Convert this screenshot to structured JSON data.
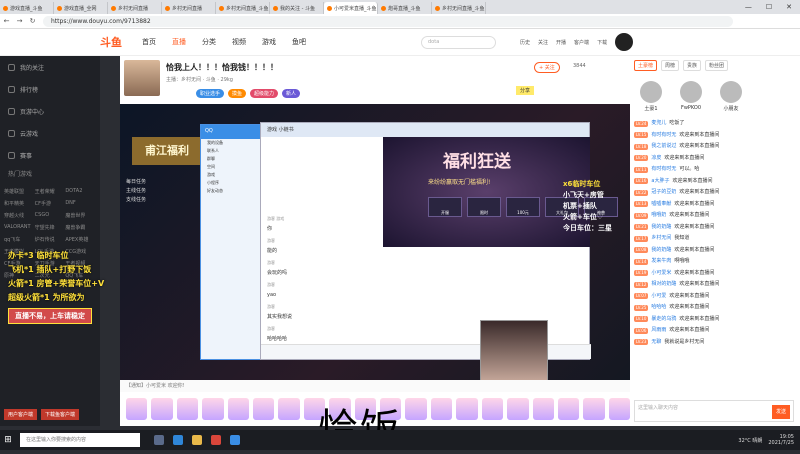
{
  "browser": {
    "tabs": [
      "游戏直播_斗鱼",
      "游戏直播_全网",
      "乡村无间直播",
      "乡村无间直播",
      "乡村无间直播_斗鱼",
      "我的关注 - 斗鱼",
      "小可爱米直播_斗鱼",
      "炮哥直播_斗鱼",
      "乡村无间直播_斗鱼"
    ],
    "url": "https://www.douyu.com/9713882"
  },
  "site": {
    "logo": "斗鱼",
    "nav": [
      "首页",
      "直播",
      "分类",
      "视频",
      "游戏",
      "鱼吧"
    ],
    "search_placeholder": "dota",
    "user_icons": [
      "历史",
      "关注",
      "开播",
      "客户端",
      "下载"
    ]
  },
  "sidebar": {
    "items": [
      "我的关注",
      "排行榜",
      "页游中心",
      "云游戏",
      "赛事"
    ],
    "section": "热门游戏",
    "games": [
      "英雄联盟",
      "王者荣耀",
      "DOTA2",
      "和平精英",
      "CF手游",
      "DNF",
      "穿越火线",
      "CSGO",
      "魔兽世界",
      "VALORANT",
      "守望先锋",
      "魔兽争霸",
      "qq飞车",
      "炉石传说",
      "APEX英雄",
      "王者模拟",
      "LOL手游",
      "CCG游戏",
      "CF手游",
      "天刀手游",
      "王者视频",
      "原神",
      "二次元",
      "QQ飞车"
    ],
    "bottom": [
      "用户客户端",
      "下载鱼客户端"
    ]
  },
  "room": {
    "title": "恰我上人！！！恰我钱！！！！",
    "streamer": "小可爱米",
    "meta": "主播：乡村无间 · 斗鱼 · 29kg",
    "tags": [
      "职业选手",
      "摸鱼",
      "超级能力",
      "新人"
    ],
    "follow_label": "+ 关注",
    "follow_count": "3844",
    "share_label": "分享"
  },
  "video": {
    "flag_text": "甫江福利",
    "tasks": [
      "每日任务",
      "主线任务",
      "支线任务"
    ],
    "qq_title": "QQ",
    "qq_rows": [
      "我的设备",
      "联系人",
      "群聊",
      "空间",
      "游戏",
      "小程序",
      "好友动态"
    ],
    "chat_title": "游戏 小链书",
    "banner_title": "福利狂送",
    "banner_sub": "来纷纷赢取无门槛福利!",
    "gift_cards": [
      "开服",
      "限时",
      "100元",
      "大礼包",
      "神兽"
    ],
    "chat_lines": [
      {
        "name": "游客 游戏",
        "text": "你"
      },
      {
        "name": "游客",
        "text": "能的"
      },
      {
        "name": "游客",
        "text": "会玩的吗"
      },
      {
        "name": "游客",
        "text": "yao"
      },
      {
        "name": "游客",
        "text": "其实我想说"
      },
      {
        "name": "游客",
        "text": "哈哈哈哈"
      }
    ],
    "overlay_left": [
      "办卡*3 临时车位",
      "飞机*1 插队+打野下饭",
      "火箭*1 房管+荣誉车位+V",
      "超级火箭*1 为所欲为"
    ],
    "overlay_box": "直播不易，上车请稳定",
    "overlay_right": [
      "x6临时车位",
      "小飞天+房管",
      "机票+插队",
      "火箭+车位♡",
      "今日车位：三星"
    ]
  },
  "gifts": {
    "notice": "【通知】小可爱米 欢迎你!",
    "big_text": "恰饭"
  },
  "right_panel": {
    "tabs": [
      "土豪榜",
      "周榜",
      "贵族",
      "粉丝团"
    ],
    "ranks": [
      "土豪1",
      "FwPKO0",
      "小朋友"
    ],
    "chat": [
      {
        "lvl": "LV.24",
        "user": "麦兜儿",
        "text": "吃饭了"
      },
      {
        "lvl": "LV.15",
        "user": "有时有时无",
        "text": "欢迎来到本直播间"
      },
      {
        "lvl": "LV.18",
        "user": "我之前说过",
        "text": "欢迎来到本直播间"
      },
      {
        "lvl": "LV.20",
        "user": "凉皮",
        "text": "欢迎来到本直播间"
      },
      {
        "lvl": "LV.11",
        "user": "有时有时无",
        "text": "可以。哈"
      },
      {
        "lvl": "LV.16",
        "user": "a大胖子",
        "text": "欢迎来到本直播间"
      },
      {
        "lvl": "LV.22",
        "user": "冠子的豆奶",
        "text": "欢迎来到本直播间"
      },
      {
        "lvl": "LV.13",
        "user": "嘘嘘奉献",
        "text": "欢迎来到本直播间"
      },
      {
        "lvl": "LV.09",
        "user": "哦哦奶",
        "text": "欢迎来到本直播间"
      },
      {
        "lvl": "LV.21",
        "user": "我的奶酪",
        "text": "欢迎来到本直播间"
      },
      {
        "lvl": "LV.17",
        "user": "乡村无间",
        "text": "我知道"
      },
      {
        "lvl": "LV.08",
        "user": "我的奶酪",
        "text": "欢迎来到本直播间"
      },
      {
        "lvl": "LV.14",
        "user": "发来牛肉",
        "text": "啊哦哦"
      },
      {
        "lvl": "LV.19",
        "user": "小可爱米",
        "text": "欢迎来到本直播间"
      },
      {
        "lvl": "LV.12",
        "user": "相对的奶酪",
        "text": "欢迎来到本直播间"
      },
      {
        "lvl": "LV.07",
        "user": "小可爱",
        "text": "欢迎来到本直播间"
      },
      {
        "lvl": "LV.25",
        "user": "哈哈哈",
        "text": "欢迎来到本直播间"
      },
      {
        "lvl": "LV.10",
        "user": "暴走的乌鸦",
        "text": "欢迎来到本直播间"
      },
      {
        "lvl": "LV.06",
        "user": "风雨雨",
        "text": "欢迎来到本直播间"
      },
      {
        "lvl": "LV.23",
        "user": "无聊",
        "text": "我就说是乡村无间"
      }
    ],
    "send_placeholder": "这里输入聊天内容",
    "send_label": "发送"
  },
  "taskbar": {
    "search_placeholder": "在这里输入你要搜索的内容",
    "weather": "32°C 晴朗",
    "time": "19:05",
    "date": "2021/7/25"
  }
}
